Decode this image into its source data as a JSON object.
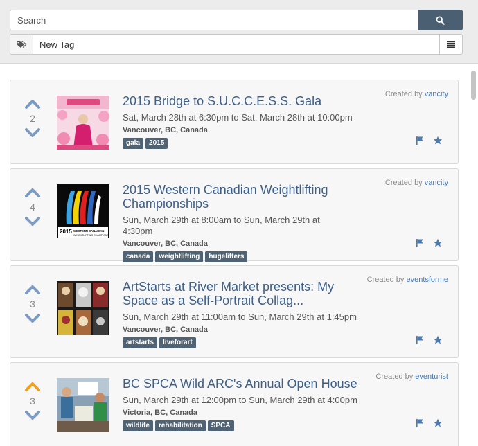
{
  "search": {
    "placeholder": "Search",
    "button_icon": "search-icon"
  },
  "tag_filter": {
    "placeholder": "New Tag",
    "icon": "tags-icon",
    "menu_icon": "list-icon"
  },
  "colors": {
    "vote_default": "#7b9bc2",
    "vote_active": "#f0a020",
    "title": "#3e5f87",
    "tag_bg": "#4f6374",
    "search_btn": "#4b5f72"
  },
  "events": [
    {
      "votes": "2",
      "upvoted": false,
      "title": "2015 Bridge to S.U.C.C.E.S.S. Gala",
      "dates": "Sat, March 28th at 6:30pm to Sat, March 28th at 10:00pm",
      "location": "Vancouver, BC, Canada",
      "tags": [
        "gala",
        "2015"
      ],
      "created_by_label": "Created by",
      "creator": "vancity"
    },
    {
      "votes": "4",
      "upvoted": false,
      "title": "2015 Western Canadian Weightlifting Championships",
      "dates": "Sun, March 29th at 8:00am to Sun, March 29th at 4:30pm",
      "location": "Vancouver, BC, Canada",
      "tags": [
        "canada",
        "weightlifting",
        "hugelifters"
      ],
      "created_by_label": "Created by",
      "creator": "vancity",
      "thumb_text": "2015 WESTERN CANADIAN WEIGHTLIFTING CHAMPIONSHIPS"
    },
    {
      "votes": "3",
      "upvoted": false,
      "title": "ArtStarts at River Market presents: My Space as a Self-Portrait Collag...",
      "dates": "Sun, March 29th at 11:00am to Sun, March 29th at 1:45pm",
      "location": "Vancouver, BC, Canada",
      "tags": [
        "artstarts",
        "liveforart"
      ],
      "created_by_label": "Created by",
      "creator": "eventsforme"
    },
    {
      "votes": "3",
      "upvoted": true,
      "title": "BC SPCA Wild ARC's Annual Open House",
      "dates": "Sun, March 29th at 12:00pm to Sun, March 29th at 4:00pm",
      "location": "Victoria, BC, Canada",
      "tags": [
        "wildlife",
        "rehabilitation",
        "SPCA"
      ],
      "created_by_label": "Created by",
      "creator": "eventurist"
    }
  ]
}
